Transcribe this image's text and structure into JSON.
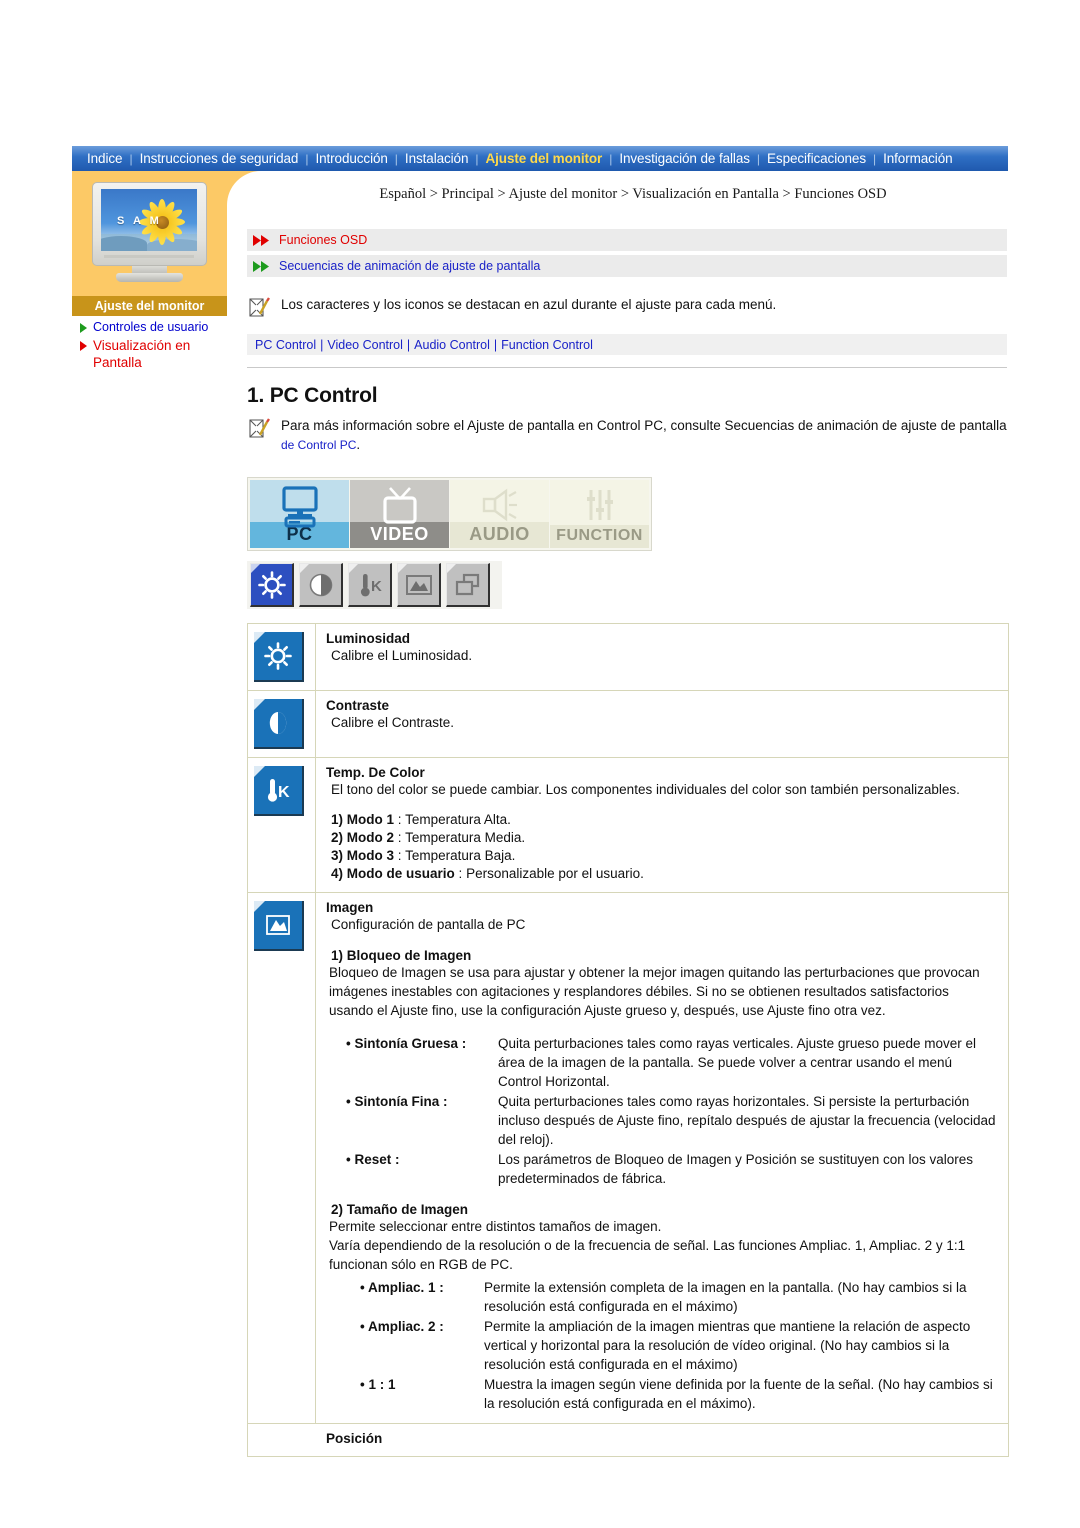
{
  "nav": {
    "items": [
      {
        "label": "Indice",
        "active": false
      },
      {
        "label": "Instrucciones de seguridad",
        "active": false
      },
      {
        "label": "Introducción",
        "active": false
      },
      {
        "label": "Instalación",
        "active": false
      },
      {
        "label": "Ajuste del monitor",
        "active": true
      },
      {
        "label": "Investigación de fallas",
        "active": false
      },
      {
        "label": "Especificaciones",
        "active": false
      },
      {
        "label": "Información",
        "active": false
      }
    ],
    "separator": "|",
    "bg_color": "#2f6fc4",
    "active_color": "#ffd94a"
  },
  "sidebar": {
    "monitor_screen_text": "S A M",
    "header": "Ajuste del monitor",
    "header_bg": "#c8941a",
    "items": [
      {
        "label": "Controles de usuario",
        "color": "#0000cd",
        "arrow_color": "#1d9b1d",
        "active": false
      },
      {
        "label": "Visualización en Pantalla",
        "color": "#e00000",
        "arrow_color": "#e00000",
        "active": true
      }
    ]
  },
  "breadcrumb": "Español > Principal > Ajuste del monitor > Visualización en Pantalla > Funciones OSD",
  "section_bars": [
    {
      "label": "Funciones OSD",
      "color": "red",
      "arrow_color": "#e00000"
    },
    {
      "label": "Secuencias de animación de ajuste de pantalla",
      "color": "blue",
      "arrow_color": "#1d9b1d"
    }
  ],
  "notice": "Los caracteres y los iconos se destacan en azul durante el ajuste para cada menú.",
  "control_links": [
    "PC Control",
    "Video Control",
    "Audio Control",
    "Function Control"
  ],
  "control_links_sep": "|",
  "heading": "1. PC Control",
  "intro": {
    "text_before": "Para más información sobre el Ajuste de pantalla en Control PC, consulte Secuencias de animación de ajuste de pantalla ",
    "link": "de Control PC",
    "text_after": "."
  },
  "osd_tabs": [
    {
      "label": "PC",
      "icon": "desktop-computer-icon",
      "state": "active"
    },
    {
      "label": "VIDEO",
      "icon": "television-icon",
      "state": "dim"
    },
    {
      "label": "AUDIO",
      "icon": "speaker-icon",
      "state": "inactive"
    },
    {
      "label": "FUNCTION",
      "icon": "sliders-icon",
      "state": "inactive"
    }
  ],
  "icon_strip": [
    {
      "icon": "brightness-sun-icon",
      "selected": true
    },
    {
      "icon": "contrast-half-circle-icon",
      "selected": false
    },
    {
      "icon": "color-temperature-icon",
      "selected": false
    },
    {
      "icon": "image-picture-icon",
      "selected": false
    },
    {
      "icon": "position-frames-icon",
      "selected": false
    }
  ],
  "features": [
    {
      "icon": "brightness-sun-icon",
      "title": "Luminosidad",
      "desc": "Calibre el Luminosidad."
    },
    {
      "icon": "contrast-half-circle-icon",
      "title": "Contraste",
      "desc": "Calibre el Contraste."
    },
    {
      "icon": "color-temperature-icon",
      "title": "Temp. De Color",
      "desc": "El tono del color se puede cambiar. Los componentes individuales del color son también personalizables.",
      "modes": [
        {
          "num": "1)",
          "name": "Modo 1",
          "sep": ":",
          "value": "Temperatura Alta."
        },
        {
          "num": "2)",
          "name": "Modo 2",
          "sep": ":",
          "value": "Temperatura Media."
        },
        {
          "num": "3)",
          "name": "Modo 3",
          "sep": ":",
          "value": "Temperatura Baja."
        },
        {
          "num": "4)",
          "name": "Modo de usuario",
          "sep": ":",
          "value": "Personalizable por el usuario."
        }
      ]
    },
    {
      "icon": "image-picture-icon",
      "title": "Imagen",
      "desc": "Configuración de pantalla de PC",
      "sub1_head": "1) Bloqueo de Imagen",
      "sub1_para": "Bloqueo de Imagen se usa para ajustar y obtener la mejor imagen quitando las perturbaciones que provocan imágenes inestables con agitaciones y resplandores débiles. Si no se obtienen resultados satisfactorios usando el Ajuste fino, use la configuración Ajuste grueso y, después, use Ajuste fino otra vez.",
      "defs1": [
        {
          "term": "• Sintonía Gruesa :",
          "desc": "Quita perturbaciones tales como rayas verticales. Ajuste grueso puede mover el área de la imagen de la pantalla. Se puede volver a centrar usando el menú Control Horizontal."
        },
        {
          "term": "• Sintonía Fina :",
          "desc": "Quita perturbaciones tales como rayas horizontales. Si persiste la perturbación incluso después de Ajuste fino, repítalo después de ajustar la frecuencia (velocidad del reloj)."
        },
        {
          "term": "• Reset :",
          "desc": "Los parámetros de Bloqueo de Imagen y Posición se sustituyen con los valores predeterminados de fábrica."
        }
      ],
      "sub2_head": "2) Tamaño de Imagen",
      "sub2_para1": "Permite seleccionar entre distintos tamaños de imagen.",
      "sub2_para2": "Varía dependiendo de la resolución o de la frecuencia de señal. Las funciones Ampliac. 1, Ampliac. 2 y 1:1 funcionan sólo en RGB de PC.",
      "defs2": [
        {
          "term": "• Ampliac. 1 :",
          "desc": "Permite la extensión completa de la imagen en la pantalla. (No hay cambios si la resolución está configurada en el máximo)"
        },
        {
          "term": "• Ampliac. 2 :",
          "desc": "Permite la ampliación de la imagen mientras que mantiene la relación de aspecto vertical y horizontal para la resolución de vídeo original. (No hay cambios si la resolución está configurada en el máximo)"
        },
        {
          "term": "• 1 : 1",
          "desc": "Muestra la imagen según viene definida por la fuente de la señal. (No hay cambios si la resolución está configurada en el máximo)."
        }
      ]
    },
    {
      "icon": "position-frames-icon",
      "title": "Posición",
      "desc": ""
    }
  ]
}
